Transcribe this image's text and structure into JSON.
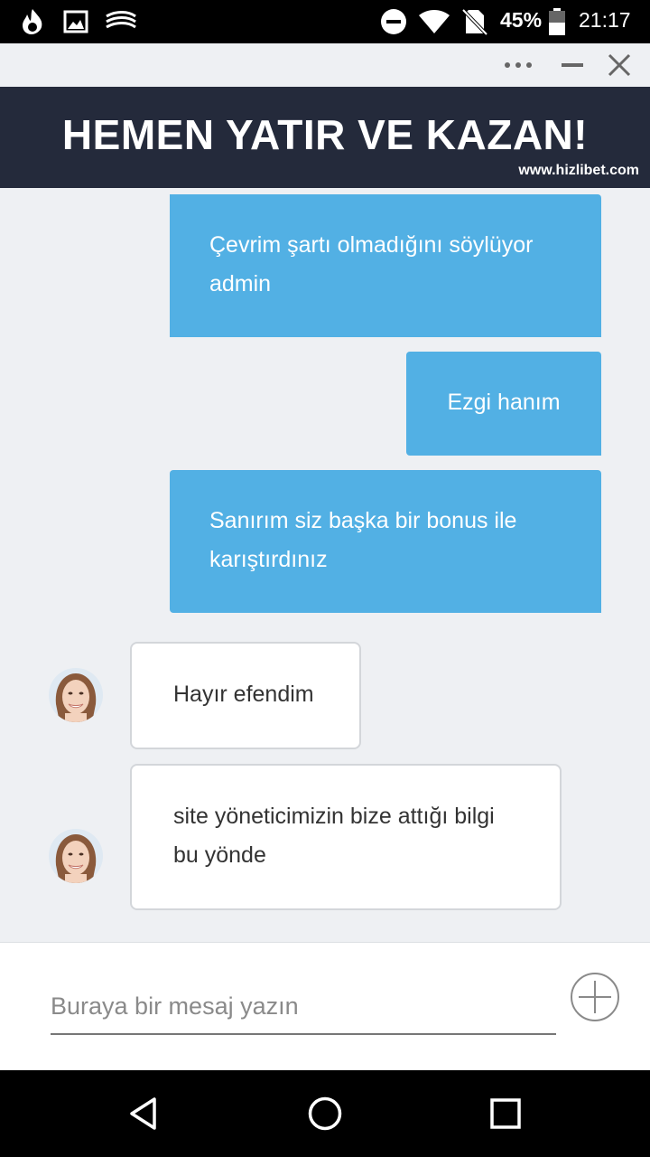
{
  "status_bar": {
    "battery_percent": "45%",
    "time": "21:17"
  },
  "banner": {
    "title": "HEMEN YATIR VE KAZAN!",
    "url": "www.hizlibet.com"
  },
  "messages": [
    {
      "from": "user",
      "text": "Çevrim şartı olmadığını söylüyor admin"
    },
    {
      "from": "user",
      "text": "Ezgi hanım"
    },
    {
      "from": "user",
      "text": "Sanırım siz başka bir bonus ile karıştırdınız"
    },
    {
      "from": "agent",
      "text": "Hayır efendim"
    },
    {
      "from": "agent",
      "text": "site yöneticimizin bize attığı bilgi bu yönde"
    }
  ],
  "composer": {
    "placeholder": "Buraya bir mesaj yazın",
    "value": ""
  },
  "colors": {
    "outgoing_bubble": "#52b0e4",
    "banner_bg": "#242a3b",
    "chat_bg": "#eef0f3"
  },
  "icons": {
    "status_left": [
      "flame-icon",
      "image-icon",
      "swiftkey-icon"
    ],
    "status_right": [
      "do-not-disturb-icon",
      "wifi-icon",
      "no-sim-icon",
      "battery-icon"
    ],
    "window": [
      "more-icon",
      "minimize-icon",
      "close-icon"
    ],
    "composer": "add-icon",
    "nav": [
      "back-icon",
      "home-icon",
      "recents-icon"
    ]
  }
}
